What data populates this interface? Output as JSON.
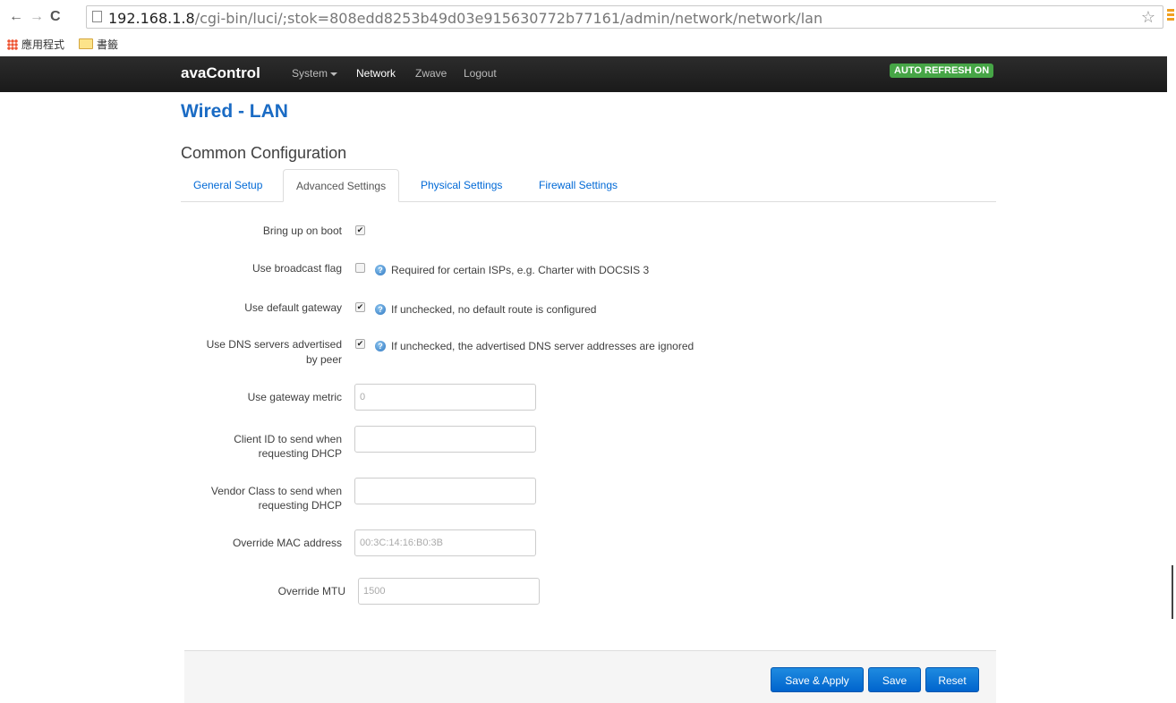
{
  "browser": {
    "url_host": "192.168.1.8",
    "url_path": "/cgi-bin/luci/;stok=808edd8253b49d03e915630772b77161/admin/network/network/lan",
    "bookmarks": [
      "應用程式",
      "書籤"
    ]
  },
  "nav": {
    "brand": "avaControl",
    "items": [
      "System",
      "Network",
      "Zwave",
      "Logout"
    ],
    "auto_refresh": "AUTO REFRESH ON"
  },
  "page": {
    "title": "Wired - LAN",
    "section": "Common Configuration",
    "tabs": [
      "General Setup",
      "Advanced Settings",
      "Physical Settings",
      "Firewall Settings"
    ],
    "active_tab": "Advanced Settings"
  },
  "form": {
    "bring_up_on_boot": {
      "label": "Bring up on boot",
      "checked": true
    },
    "use_broadcast_flag": {
      "label": "Use broadcast flag",
      "checked": false,
      "hint": "Required for certain ISPs, e.g. Charter with DOCSIS 3"
    },
    "use_default_gateway": {
      "label": "Use default gateway",
      "checked": true,
      "hint": "If unchecked, no default route is configured"
    },
    "use_peer_dns": {
      "label_line1": "Use DNS servers advertised",
      "label_line2": "by peer",
      "checked": true,
      "hint": "If unchecked, the advertised DNS server addresses are ignored"
    },
    "gateway_metric": {
      "label": "Use gateway metric",
      "value": "",
      "placeholder": "0"
    },
    "client_id": {
      "label_line1": "Client ID to send when",
      "label_line2": "requesting DHCP",
      "value": "",
      "placeholder": ""
    },
    "vendor_class": {
      "label_line1": "Vendor Class to send when",
      "label_line2": "requesting DHCP",
      "value": "",
      "placeholder": ""
    },
    "override_mac": {
      "label": "Override MAC address",
      "value": "",
      "placeholder": "00:3C:14:16:B0:3B"
    },
    "override_mtu": {
      "label": "Override MTU",
      "value": "",
      "placeholder": "1500"
    }
  },
  "buttons": {
    "save_apply": "Save & Apply",
    "save": "Save",
    "reset": "Reset"
  },
  "colors": {
    "title_blue": "#1a6bc4",
    "link_blue": "#0069d6",
    "button_blue": "#0064cd",
    "refresh_green": "#46a546",
    "topbar": "#1f1f1f"
  }
}
